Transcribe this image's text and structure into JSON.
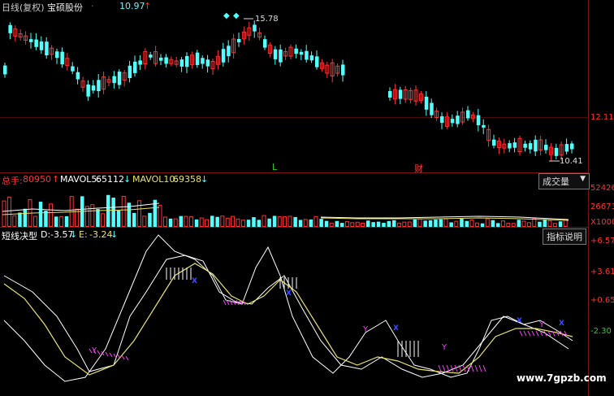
{
  "header": {
    "period_label": "日线(复权)",
    "stock_name": "宝硕股份",
    "price": "10.97",
    "price_arrow": "↑",
    "high_label": "15.78",
    "low_label": "10.41",
    "marker_L": "L",
    "marker_cai": "财"
  },
  "price_axis": {
    "label_12": "12.11"
  },
  "volume_panel": {
    "total_label": "总手:",
    "total_value": "80950",
    "total_arrow": "↑",
    "mavol5_label": "MAVOL5:",
    "mavol5_value": "65112",
    "mavol5_arrow": "↓",
    "mavol10_label": "MAVOL10:",
    "mavol10_value": "69358",
    "mavol10_arrow": "↓",
    "dropdown": "成交量",
    "axis_top": "52426",
    "axis_mid": "26673",
    "axis_unit": "X1000"
  },
  "indicator_panel": {
    "name": "短线决型",
    "d_label": "D:",
    "d_value": "-3.57",
    "d_arrow": "↓",
    "e_label": "E:",
    "e_value": "-3.24",
    "e_arrow": "↓",
    "help_button": "指标说明",
    "axis_1": "+6.57",
    "axis_2": "+3.61",
    "axis_3": "+0.650",
    "axis_4": "-2.30",
    "marker_Y": "Y"
  },
  "watermark": "www.7gpzb.com",
  "colors": {
    "up": "#ff3232",
    "down": "#54ffff",
    "white": "#ffffff",
    "yellow": "#e8e26a",
    "grid": "#7a1010",
    "blue": "#3b4bff",
    "magenta": "#ff3cff",
    "green": "#33cc33"
  }
}
